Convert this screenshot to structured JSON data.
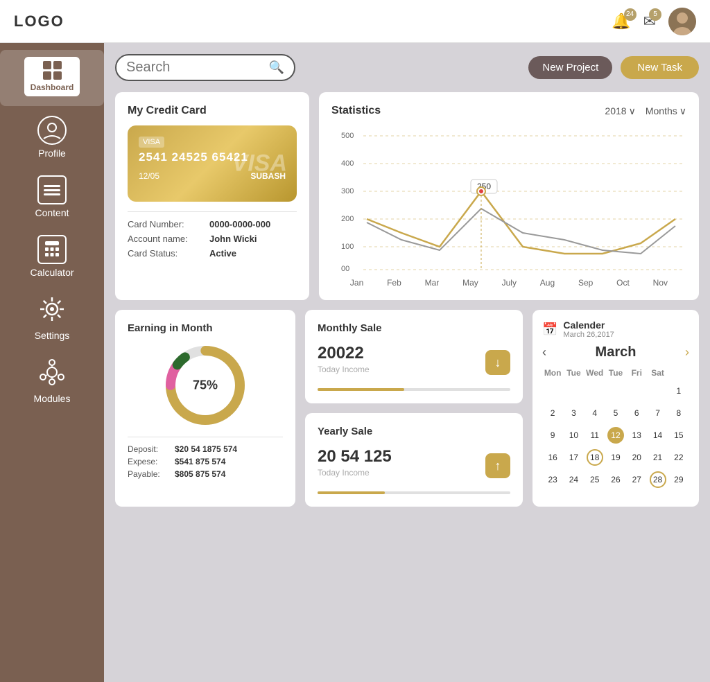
{
  "header": {
    "logo": "LOGO",
    "notifications_count": "24",
    "messages_count": "5"
  },
  "sidebar": {
    "items": [
      {
        "id": "dashboard",
        "label": "Dashboard",
        "icon": "⊞",
        "active": true
      },
      {
        "id": "profile",
        "label": "Profile",
        "icon": "👤"
      },
      {
        "id": "content",
        "label": "Content",
        "icon": "📋"
      },
      {
        "id": "calculator",
        "label": "Calculator",
        "icon": "🖩"
      },
      {
        "id": "settings",
        "label": "Settings",
        "icon": "⚙"
      },
      {
        "id": "modules",
        "label": "Modules",
        "icon": "🔗"
      }
    ]
  },
  "topbar": {
    "search_placeholder": "Search",
    "btn_new_project": "New Project",
    "btn_new_task": "New Task"
  },
  "credit_card": {
    "title": "My Credit Card",
    "visa_label": "VISA",
    "card_number": "2541  24525  65421",
    "expiry": "12/05",
    "name": "SUBASH",
    "watermark": "VISA",
    "info_card_number_label": "Card Number:",
    "info_card_number_value": "0000-0000-000",
    "info_account_label": "Account name:",
    "info_account_value": "John Wicki",
    "info_status_label": "Card Status:",
    "info_status_value": "Active"
  },
  "statistics": {
    "title": "Statistics",
    "year": "2018",
    "period": "Months",
    "y_labels": [
      "500",
      "400",
      "300",
      "200",
      "100",
      "00"
    ],
    "x_labels": [
      "Jan",
      "Feb",
      "Mar",
      "May",
      "July",
      "Aug",
      "Sep",
      "Oct",
      "Nov"
    ],
    "tooltip_value": "250",
    "tooltip_month": "May"
  },
  "earning": {
    "title": "Earning in Month",
    "percentage": "75%",
    "deposit_label": "Deposit:",
    "deposit_value": "$20 54 1875 574",
    "expense_label": "Expese:",
    "expense_value": "$541 875 574",
    "payable_label": "Payable:",
    "payable_value": "$805 875 574"
  },
  "monthly_sale": {
    "title": "Monthly Sale",
    "amount": "20022",
    "label": "Today Income",
    "progress": 45,
    "btn_icon": "↓"
  },
  "yearly_sale": {
    "title": "Yearly Sale",
    "amount": "20 54 125",
    "label": "Today Income",
    "progress": 35,
    "btn_icon": "↑"
  },
  "calendar": {
    "title": "Calender",
    "date": "March 26,2017",
    "month": "March",
    "day_headers": [
      "Mon",
      "Tue",
      "Wed",
      "Tue",
      "Fri",
      "Sat"
    ],
    "weeks": [
      [
        null,
        null,
        null,
        null,
        null,
        null,
        "1"
      ],
      [
        "2",
        "3",
        "4",
        "5",
        "6",
        "7",
        "8"
      ],
      [
        "9",
        "10",
        "11",
        "12",
        "13",
        "14",
        "15"
      ],
      [
        "16",
        "17",
        "18",
        "19",
        "20",
        "21",
        "22"
      ],
      [
        "23",
        "24",
        "25",
        "26",
        "27",
        "28",
        "29"
      ]
    ],
    "highlighted_days": [
      "12"
    ],
    "outlined_days": [
      "18",
      "28"
    ]
  }
}
